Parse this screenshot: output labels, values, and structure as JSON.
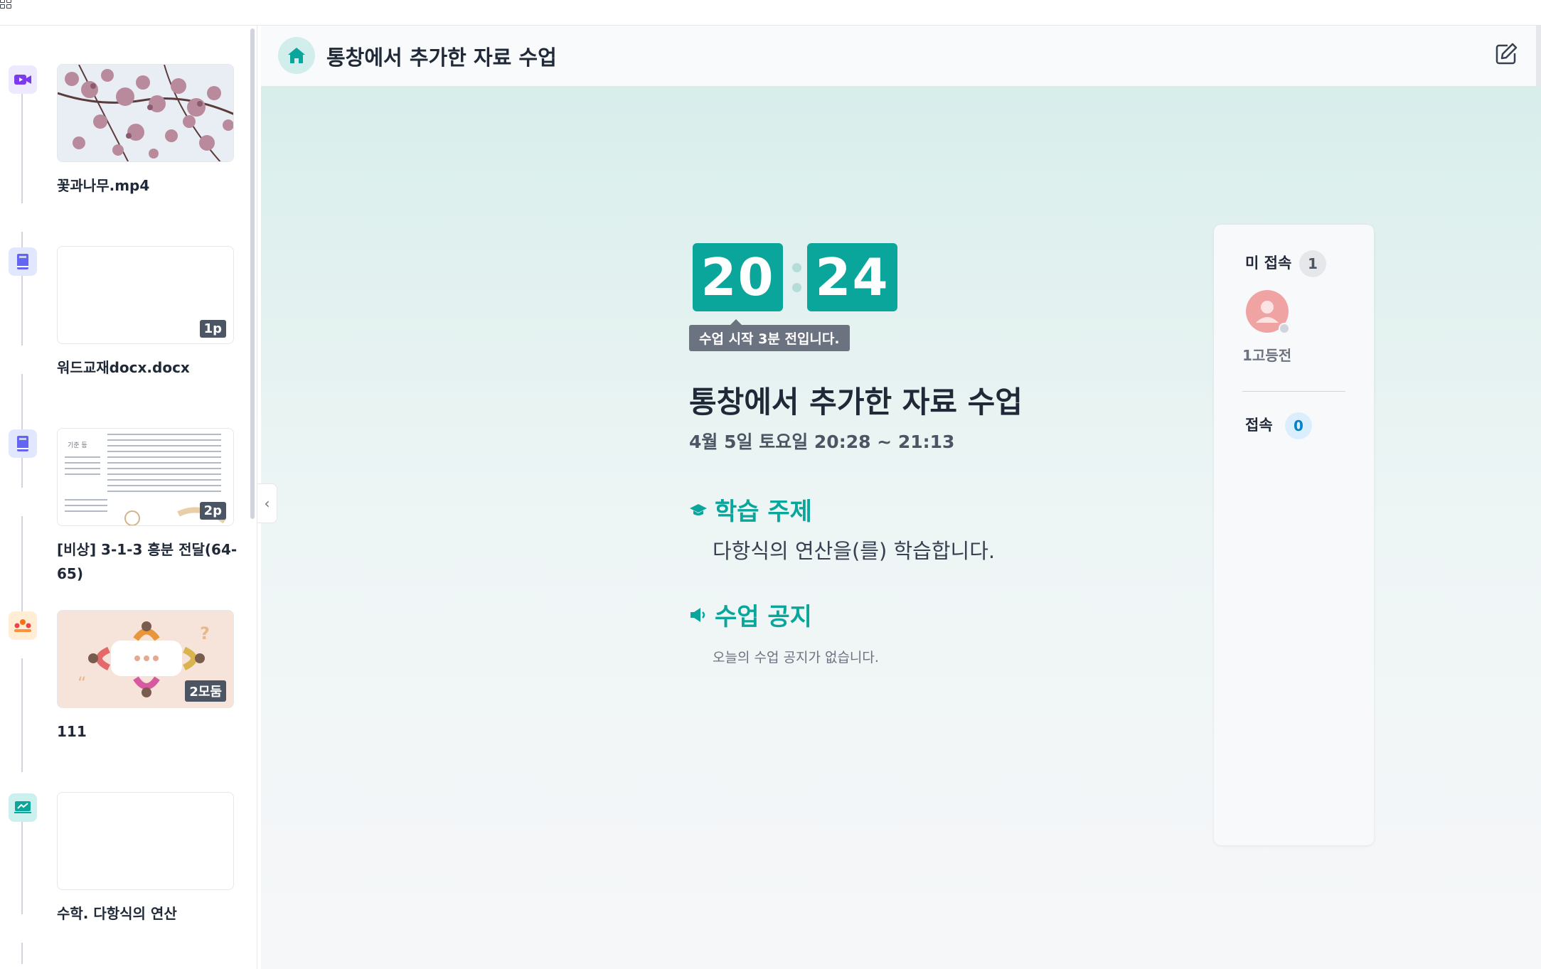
{
  "header": {
    "title": "통창에서 추가한 자료 수업"
  },
  "sidebar": {
    "items": [
      {
        "title": "꽃과나무.mp4",
        "badge": "",
        "icon": "video-icon",
        "icon_color": "#7c3aed"
      },
      {
        "title": "워드교재docx.docx",
        "badge": "1p",
        "icon": "book-icon",
        "icon_color": "#6366f1"
      },
      {
        "title": "[비상] 3-1-3 흥분 전달(64-65)",
        "badge": "2p",
        "icon": "book-icon",
        "icon_color": "#6366f1"
      },
      {
        "title": "111",
        "badge": "2모둠",
        "icon": "group-icon",
        "icon_color": "#f97316"
      },
      {
        "title": "수학. 다항식의 연산",
        "badge": "",
        "icon": "board-icon",
        "icon_color": "#0aa59b"
      }
    ]
  },
  "clock": {
    "hours": "20",
    "minutes": "24",
    "notice": "수업 시작 3분 전입니다."
  },
  "lesson": {
    "title": "통창에서 추가한 자료 수업",
    "time": "4월 5일 토요일 20:28 ~ 21:13",
    "topic_heading": "학습 주제",
    "topic_body": "다항식의 연산을(를) 학습합니다.",
    "notice_heading": "수업 공지",
    "notice_body": "오늘의 수업 공지가 없습니다."
  },
  "attendance": {
    "absent_label": "미 접속",
    "absent_count": "1",
    "student_name": "1고등전",
    "present_label": "접속",
    "present_count": "0"
  },
  "colors": {
    "accent": "#0aa59b",
    "badge": "#4b5563"
  }
}
